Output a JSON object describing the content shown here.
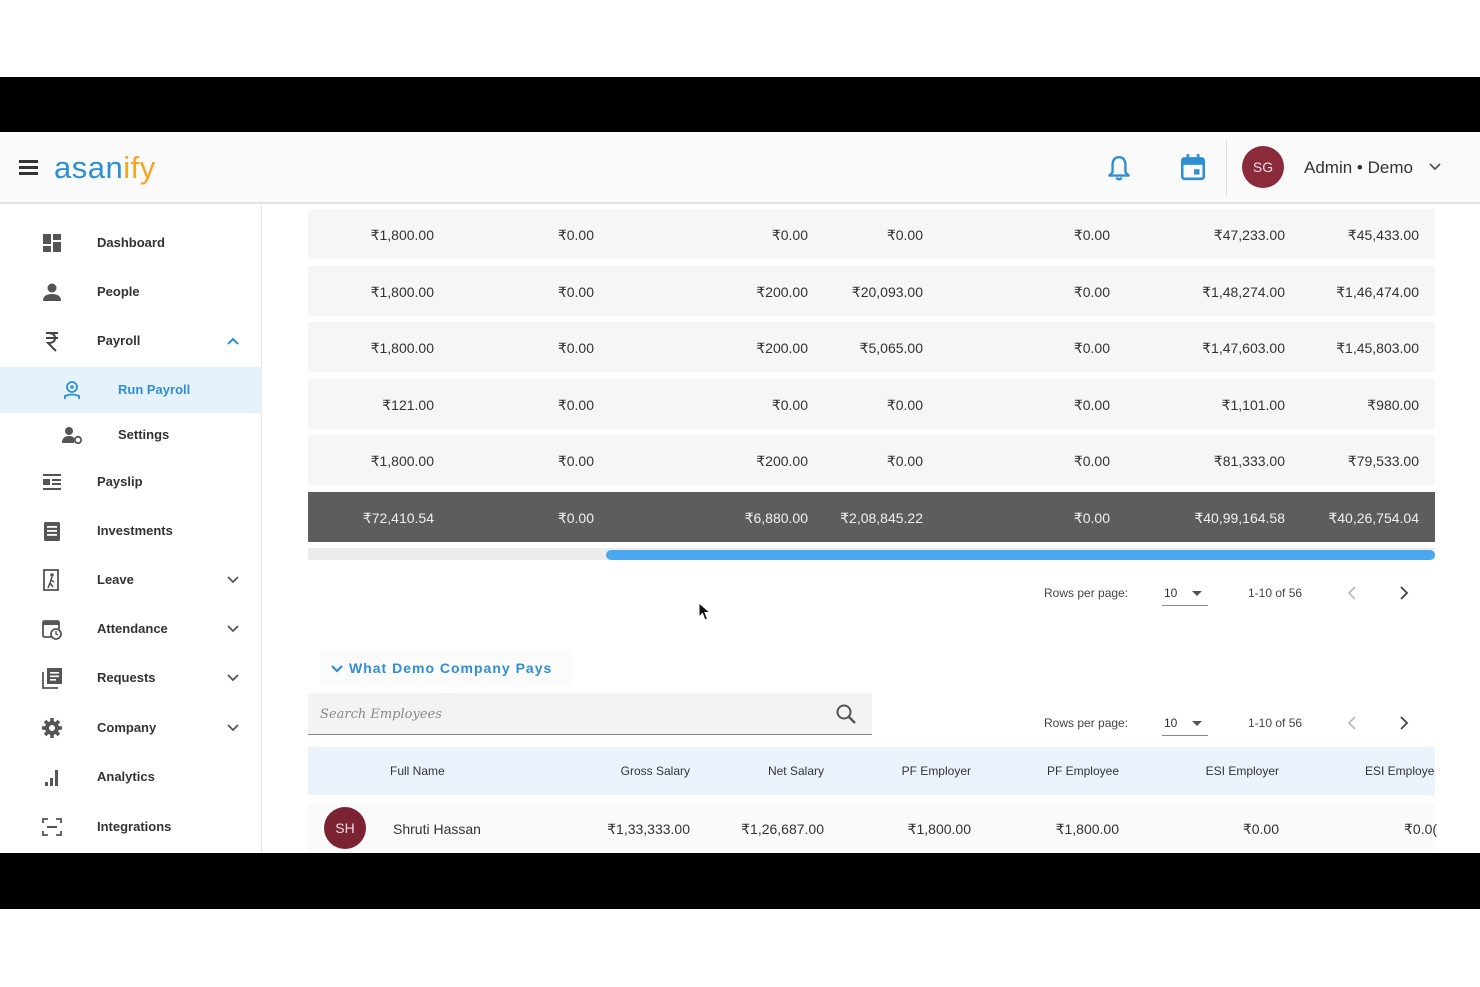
{
  "header": {
    "logo_part1": "asan",
    "logo_part2": "ify",
    "avatar_initials": "SG",
    "user_label": "Admin • Demo"
  },
  "sidebar": {
    "items": [
      {
        "label": "Dashboard",
        "icon": "dashboard-icon"
      },
      {
        "label": "People",
        "icon": "person-icon"
      },
      {
        "label": "Payroll",
        "icon": "rupee-icon",
        "expanded": true
      },
      {
        "label": "Run Payroll",
        "icon": "run-payroll-icon",
        "active": true
      },
      {
        "label": "Settings",
        "icon": "user-settings-icon"
      },
      {
        "label": "Payslip",
        "icon": "payslip-icon"
      },
      {
        "label": "Investments",
        "icon": "investments-icon"
      },
      {
        "label": "Leave",
        "icon": "leave-icon"
      },
      {
        "label": "Attendance",
        "icon": "attendance-icon"
      },
      {
        "label": "Requests",
        "icon": "requests-icon"
      },
      {
        "label": "Company",
        "icon": "gear-icon"
      },
      {
        "label": "Analytics",
        "icon": "analytics-icon"
      },
      {
        "label": "Integrations",
        "icon": "integrations-icon"
      }
    ]
  },
  "table1": {
    "rows": [
      [
        "₹1,800.00",
        "₹0.00",
        "₹0.00",
        "₹0.00",
        "₹0.00",
        "₹47,233.00",
        "₹45,433.00"
      ],
      [
        "₹1,800.00",
        "₹0.00",
        "₹200.00",
        "₹20,093.00",
        "₹0.00",
        "₹1,48,274.00",
        "₹1,46,474.00"
      ],
      [
        "₹1,800.00",
        "₹0.00",
        "₹200.00",
        "₹5,065.00",
        "₹0.00",
        "₹1,47,603.00",
        "₹1,45,803.00"
      ],
      [
        "₹121.00",
        "₹0.00",
        "₹0.00",
        "₹0.00",
        "₹0.00",
        "₹1,101.00",
        "₹980.00"
      ],
      [
        "₹1,800.00",
        "₹0.00",
        "₹200.00",
        "₹0.00",
        "₹0.00",
        "₹81,333.00",
        "₹79,533.00"
      ]
    ],
    "total": [
      "₹72,410.54",
      "₹0.00",
      "₹6,880.00",
      "₹2,08,845.22",
      "₹0.00",
      "₹40,99,164.58",
      "₹40,26,754.04"
    ],
    "pager": {
      "rows_per_page_label": "Rows per page:",
      "rows_per_page": "10",
      "range": "1-10 of 56"
    }
  },
  "section2": {
    "title": "What Demo Company Pays",
    "search_placeholder": "Search Employees",
    "pager": {
      "rows_per_page_label": "Rows per page:",
      "rows_per_page": "10",
      "range": "1-10 of 56"
    },
    "columns": [
      "Full Name",
      "Gross Salary",
      "Net Salary",
      "PF Employer",
      "PF Employee",
      "ESI Employer",
      "ESI Employe"
    ],
    "rows": [
      {
        "initials": "SH",
        "name": "Shruti Hassan",
        "gross": "₹1,33,333.00",
        "net": "₹1,26,687.00",
        "pf_employer": "₹1,800.00",
        "pf_employee": "₹1,800.00",
        "esi_employer": "₹0.00",
        "esi_employee": "₹0.0("
      }
    ]
  },
  "colors": {
    "brand_blue": "#2f8fd3",
    "brand_orange": "#f5a524",
    "avatar": "#8a2a3a",
    "total_row": "#5d5d5d",
    "scroll_thumb": "#4aa8f0"
  }
}
